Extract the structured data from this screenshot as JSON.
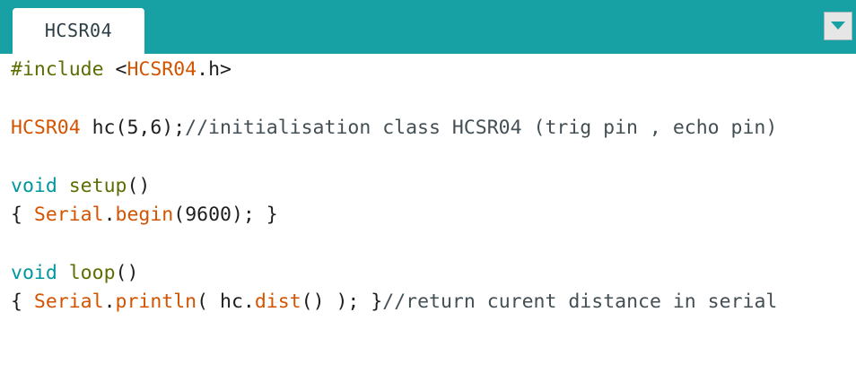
{
  "tabs": [
    {
      "label": "HCSR04",
      "active": true
    }
  ],
  "tab_menu": {
    "icon": "triangle-down-icon"
  },
  "colors": {
    "tabbar": "#17a1a5",
    "directive": "#5e6d03",
    "keyword": "#00979d",
    "function": "#5e6d03",
    "class": "#d35400",
    "comment": "#434f54"
  },
  "code": {
    "line1": {
      "directive": "#include",
      "lt": " <",
      "header": "HCSR04",
      "rest": ".h>"
    },
    "line3": {
      "cls": "HCSR04",
      "decl": " hc(5,6);",
      "comment": "//initialisation class HCSR04 (trig pin , echo pin)"
    },
    "line5": {
      "kw": "void",
      "sp": " ",
      "fn": "setup",
      "parens": "()"
    },
    "line6": {
      "brace": "{ ",
      "obj": "Serial",
      "dot": ".",
      "method": "begin",
      "args": "(9600); }"
    },
    "line8": {
      "kw": "void",
      "sp": " ",
      "fn": "loop",
      "parens": "()"
    },
    "line9": {
      "brace": "{ ",
      "obj": "Serial",
      "dot": ".",
      "method": "println",
      "open": "( hc.",
      "call": "dist",
      "close": "() ); }",
      "comment": "//return curent distance in serial"
    }
  }
}
